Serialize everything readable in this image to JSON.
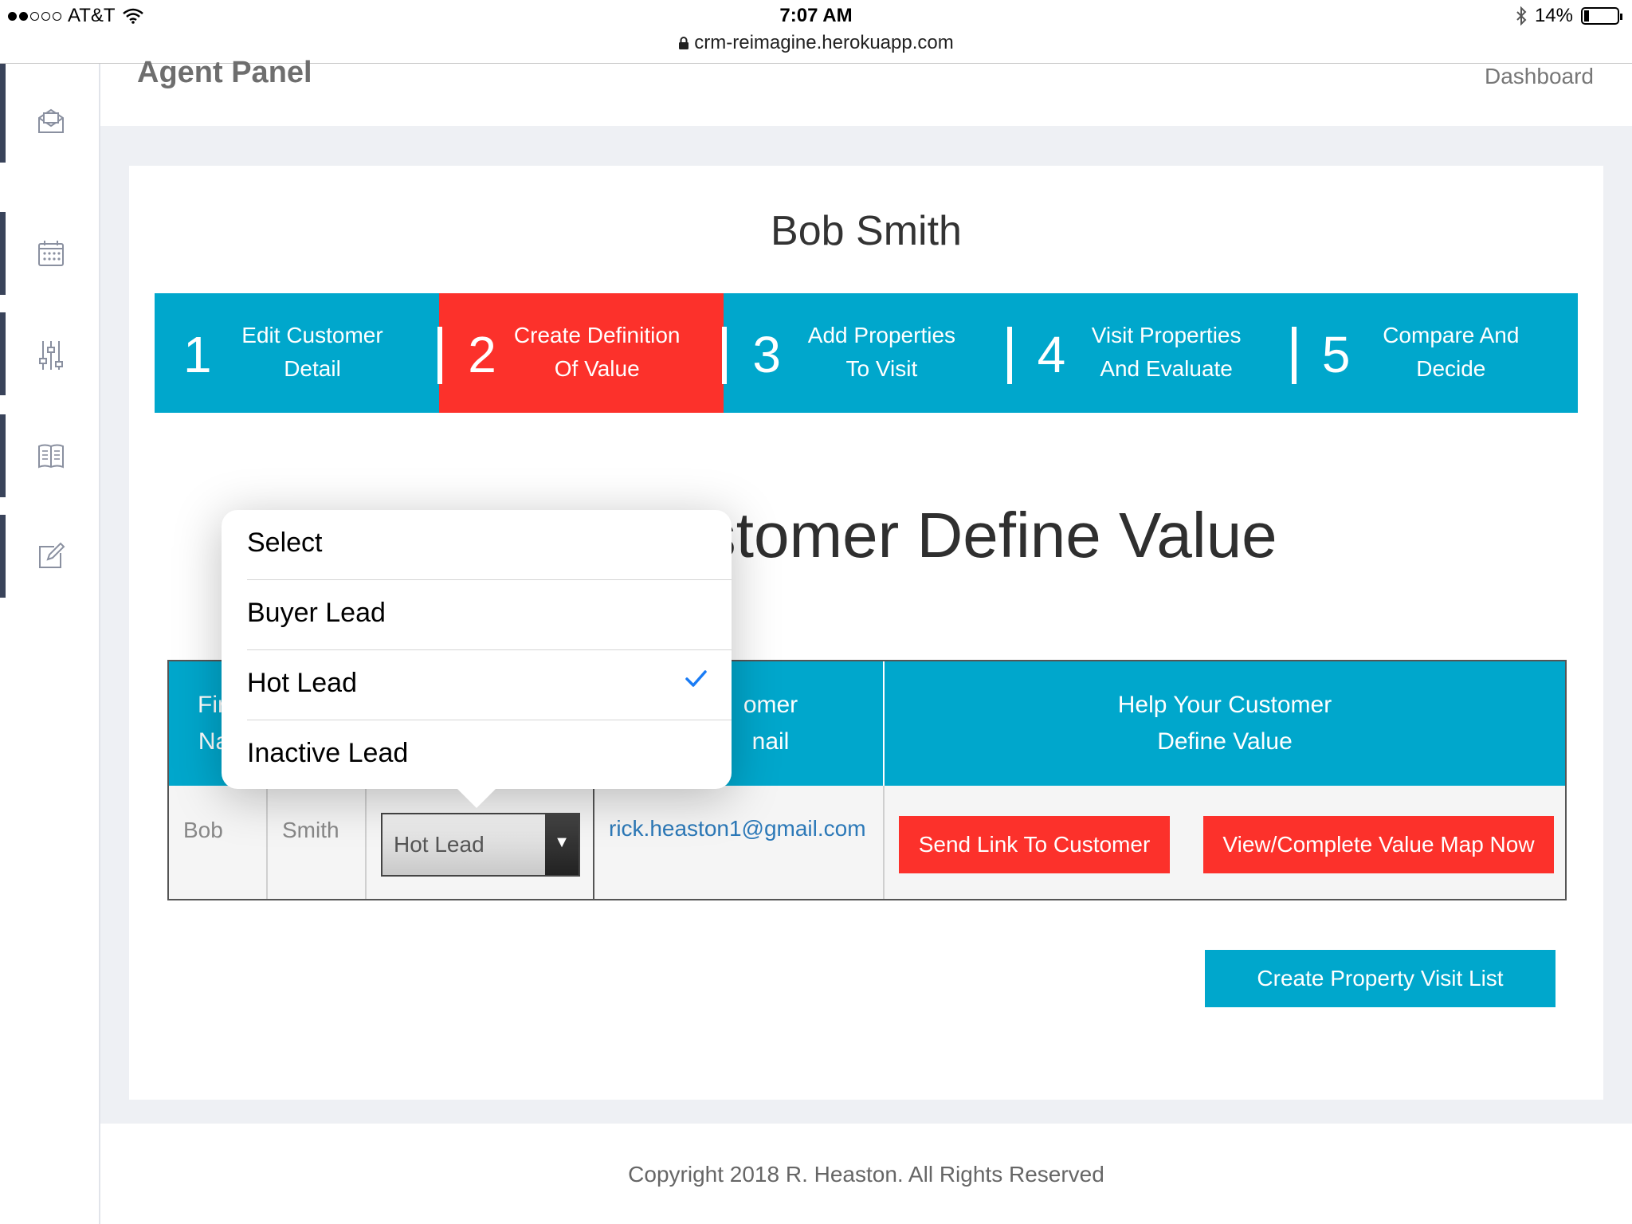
{
  "status_bar": {
    "carrier": "AT&T",
    "time": "7:07 AM",
    "url": "crm-reimagine.herokuapp.com",
    "battery": "14%",
    "battery_level": 0.14
  },
  "header": {
    "title": "Agent Panel",
    "dashboard_link": "Dashboard"
  },
  "sidebar": {
    "items": [
      {
        "icon": "mail-icon"
      },
      {
        "icon": "calendar-icon"
      },
      {
        "icon": "sliders-icon"
      },
      {
        "icon": "book-icon"
      },
      {
        "icon": "edit-icon"
      }
    ]
  },
  "customer": {
    "name": "Bob Smith"
  },
  "steps": [
    {
      "number": "1",
      "line1": "Edit Customer",
      "line2": "Detail",
      "active": false
    },
    {
      "number": "2",
      "line1": "Create Definition",
      "line2": "Of Value",
      "active": true
    },
    {
      "number": "3",
      "line1": "Add Properties",
      "line2": "To Visit",
      "active": false
    },
    {
      "number": "4",
      "line1": "Visit Properties",
      "line2": "And Evaluate",
      "active": false
    },
    {
      "number": "5",
      "line1": "Compare And",
      "line2": "Decide",
      "active": false
    }
  ],
  "section_title": "ustomer Define Value",
  "table": {
    "headers": {
      "first_name_1": "Firs",
      "first_name_2": "Nar",
      "email_1": "omer",
      "email_2": "nail",
      "help_1": "Help Your Customer",
      "help_2": "Define Value"
    },
    "row": {
      "first_name": "Bob",
      "last_name": "Smith",
      "lead_status": "Hot Lead",
      "email": "rick.heaston1@gmail.com"
    }
  },
  "buttons": {
    "send_link": "Send Link To Customer",
    "view_map": "View/Complete Value Map Now",
    "create_visit_list": "Create Property Visit List"
  },
  "dropdown": {
    "options": [
      "Select",
      "Buyer Lead",
      "Hot Lead",
      "Inactive Lead"
    ],
    "selected": "Hot Lead"
  },
  "footer": {
    "copyright": "Copyright 2018 R. Heaston. All Rights Reserved"
  },
  "colors": {
    "accent_blue": "#00a7cc",
    "accent_red": "#fc312b",
    "sidebar_bar": "#39435a"
  }
}
